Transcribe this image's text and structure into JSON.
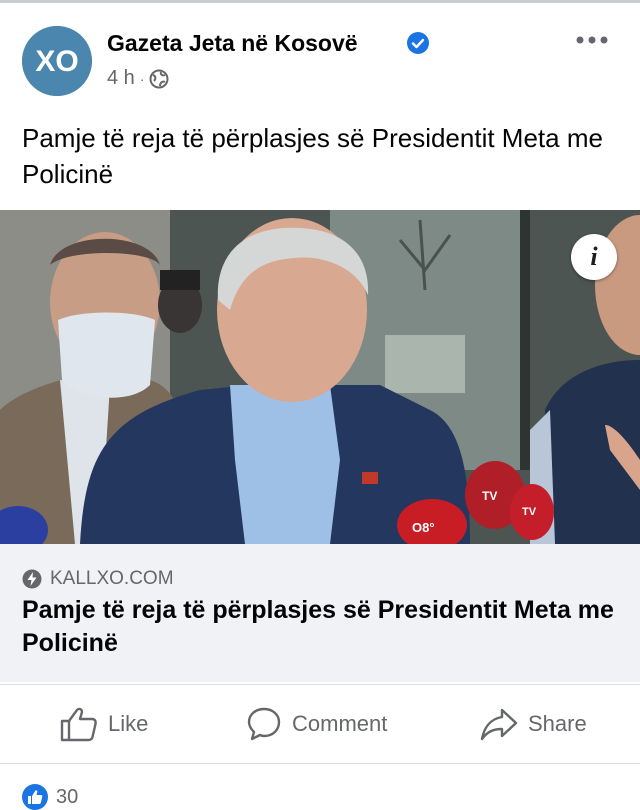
{
  "post": {
    "page_name": "Gazeta Jeta në Kosovë",
    "avatar_text": "XO",
    "time": "4 h",
    "separator": "·",
    "text": "Pamje të reja të përplasjes së Presidentit Meta me Policinë"
  },
  "link": {
    "domain": "KALLXO.COM",
    "title": "Pamje të reja të përplasjes së Presidentit Meta me Policinë"
  },
  "mic_labels": [
    "O8°",
    "TV",
    "TV"
  ],
  "actions": {
    "like": "Like",
    "comment": "Comment",
    "share": "Share"
  },
  "reactions": {
    "count": "30"
  },
  "icons": [
    "verified-badge-icon",
    "globe-icon",
    "more-options-icon",
    "info-icon",
    "bolt-icon",
    "thumbs-up-icon",
    "comment-icon",
    "share-icon"
  ],
  "colors": {
    "accent": "#1b74e4",
    "secondary_text": "#65676b",
    "link_bg": "#f0f2f5"
  }
}
